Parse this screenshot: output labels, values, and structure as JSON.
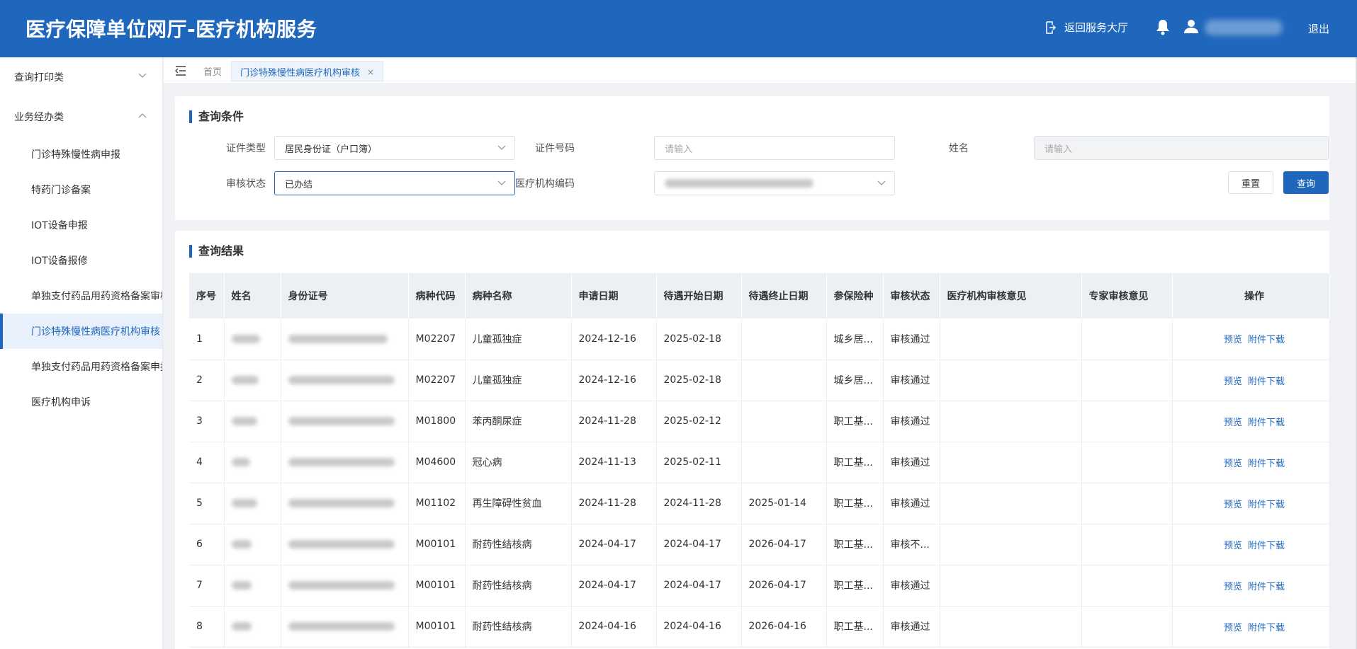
{
  "header": {
    "title": "医疗保障单位网厅-医疗机构服务",
    "back_label": "返回服务大厅",
    "logout_label": "退出"
  },
  "sidebar": {
    "groups": [
      {
        "label": "查询打印类",
        "expanded": false
      },
      {
        "label": "业务经办类",
        "expanded": true
      }
    ],
    "items": [
      {
        "label": "门诊特殊慢性病申报"
      },
      {
        "label": "特药门诊备案"
      },
      {
        "label": "IOT设备申报"
      },
      {
        "label": "IOT设备报修"
      },
      {
        "label": "单独支付药品用药资格备案审核"
      },
      {
        "label": "门诊特殊慢性病医疗机构审核",
        "active": true
      },
      {
        "label": "单独支付药品用药资格备案申报"
      },
      {
        "label": "医疗机构申诉"
      }
    ]
  },
  "tabs": {
    "home": "首页",
    "active_tab": "门诊特殊慢性病医疗机构审核",
    "close": "×"
  },
  "query": {
    "title": "查询条件",
    "cert_type_label": "证件类型",
    "cert_type_value": "居民身份证（户口簿）",
    "cert_no_label": "证件号码",
    "cert_no_placeholder": "请输入",
    "name_label": "姓名",
    "name_placeholder": "请输入",
    "status_label": "审核状态",
    "status_value": "已办结",
    "org_code_label": "医疗机构编码",
    "reset_label": "重置",
    "search_label": "查询"
  },
  "result": {
    "title": "查询结果",
    "columns": [
      "序号",
      "姓名",
      "身份证号",
      "病种代码",
      "病种名称",
      "申请日期",
      "待遇开始日期",
      "待遇终止日期",
      "参保险种",
      "审核状态",
      "医疗机构审核意见",
      "专家审核意见",
      "操作"
    ],
    "preview_label": "预览",
    "download_label": "附件下载",
    "rows": [
      {
        "no": "1",
        "code": "M02207",
        "disease": "儿童孤独症",
        "apply": "2024-12-16",
        "start": "2025-02-18",
        "end": "",
        "insurance": "城乡居...",
        "status": "审核通过"
      },
      {
        "no": "2",
        "code": "M02207",
        "disease": "儿童孤独症",
        "apply": "2024-12-16",
        "start": "2025-02-18",
        "end": "",
        "insurance": "城乡居...",
        "status": "审核通过"
      },
      {
        "no": "3",
        "code": "M01800",
        "disease": "苯丙酮尿症",
        "apply": "2024-11-28",
        "start": "2025-02-12",
        "end": "",
        "insurance": "职工基...",
        "status": "审核通过"
      },
      {
        "no": "4",
        "code": "M04600",
        "disease": "冠心病",
        "apply": "2024-11-13",
        "start": "2025-02-11",
        "end": "",
        "insurance": "职工基...",
        "status": "审核通过"
      },
      {
        "no": "5",
        "code": "M01102",
        "disease": "再生障碍性贫血",
        "apply": "2024-11-28",
        "start": "2024-11-28",
        "end": "2025-01-14",
        "insurance": "职工基...",
        "status": "审核通过"
      },
      {
        "no": "6",
        "code": "M00101",
        "disease": "耐药性结核病",
        "apply": "2024-04-17",
        "start": "2024-04-17",
        "end": "2026-04-17",
        "insurance": "职工基...",
        "status": "审核不..."
      },
      {
        "no": "7",
        "code": "M00101",
        "disease": "耐药性结核病",
        "apply": "2024-04-17",
        "start": "2024-04-17",
        "end": "2026-04-17",
        "insurance": "职工基...",
        "status": "审核通过"
      },
      {
        "no": "8",
        "code": "M00101",
        "disease": "耐药性结核病",
        "apply": "2024-04-16",
        "start": "2024-04-16",
        "end": "2026-04-16",
        "insurance": "职工基...",
        "status": "审核通过"
      }
    ]
  }
}
